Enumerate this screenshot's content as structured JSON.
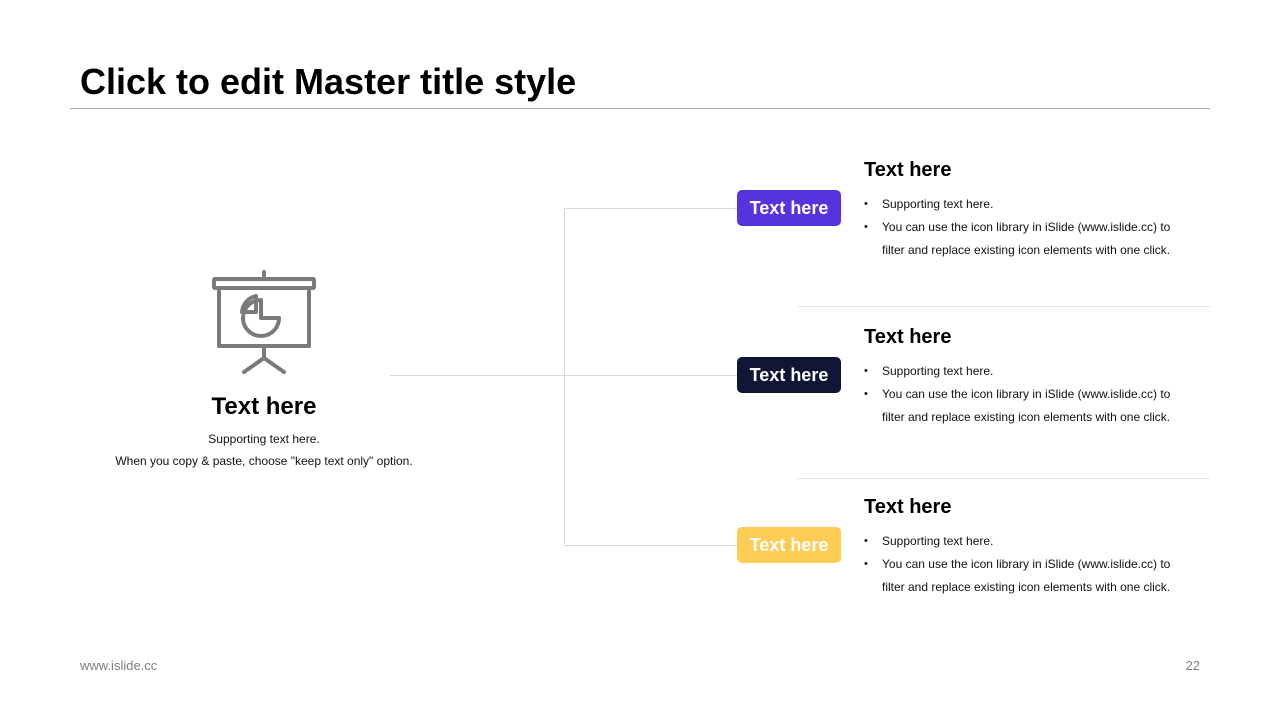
{
  "slide": {
    "title": "Click to edit Master title style",
    "footer_url": "www.islide.cc",
    "page_number": "22"
  },
  "left": {
    "icon": "presentation-board-pie-chart-icon",
    "heading": "Text here",
    "sub_line1": "Supporting text here.",
    "sub_line2": "When you copy & paste, choose \"keep text only\" option."
  },
  "items": [
    {
      "tag_label": "Text here",
      "tag_color": "#5533DD",
      "heading": "Text here",
      "bullet1": "Supporting text here.",
      "bullet2": "You can use the icon library in iSlide  (www.islide.cc) to filter and replace existing icon elements with one click."
    },
    {
      "tag_label": "Text here",
      "tag_color": "#0F1535",
      "heading": "Text here",
      "bullet1": "Supporting text here.",
      "bullet2": "You can use the icon library in iSlide  (www.islide.cc) to filter and replace existing icon elements with one click."
    },
    {
      "tag_label": "Text here",
      "tag_color": "#FFCC55",
      "heading": "Text here",
      "bullet1": "Supporting text here.",
      "bullet2": "You can use the icon library in iSlide  (www.islide.cc) to filter and replace existing icon elements with one click."
    }
  ]
}
